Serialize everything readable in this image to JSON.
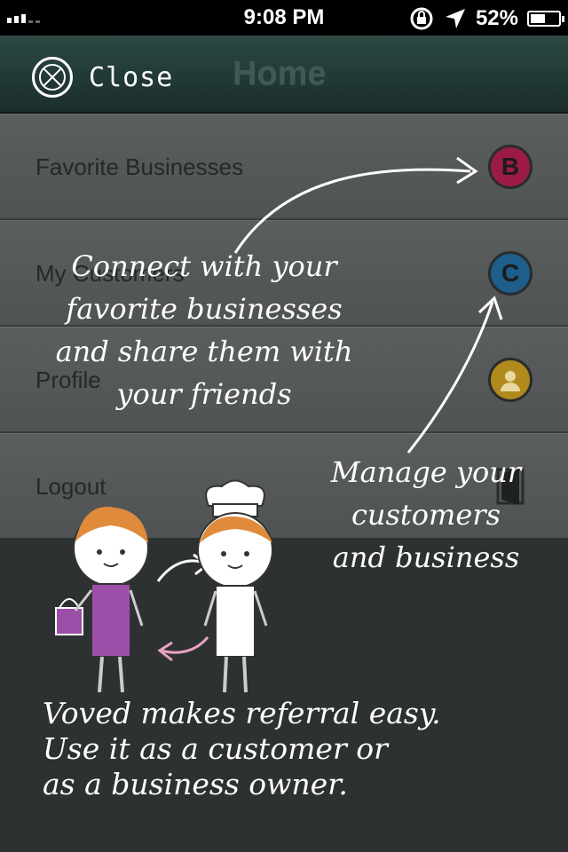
{
  "status_bar": {
    "time": "9:08 PM",
    "battery": "52%",
    "battery_level": 0.52
  },
  "nav": {
    "close_label": "Close",
    "title": "Home"
  },
  "menu": {
    "items": [
      {
        "label": "Favorite Businesses",
        "icon": "favorite-businesses-icon",
        "icon_text": "B"
      },
      {
        "label": "My Customers",
        "icon": "my-customers-icon",
        "icon_text": "C"
      },
      {
        "label": "Profile",
        "icon": "profile-icon",
        "icon_text": ""
      },
      {
        "label": "Logout",
        "icon": "logout-icon",
        "icon_text": ""
      }
    ]
  },
  "overlay": {
    "connect_lines": [
      "Connect with your",
      "favorite businesses",
      "and share them with",
      "your friends"
    ],
    "manage_lines": [
      "Manage your",
      "customers",
      "and business"
    ],
    "bottom_lines": [
      "Voved makes referral easy.",
      "Use it as a customer or",
      "as a business owner."
    ]
  },
  "colors": {
    "navbar": "#22393a",
    "menu_bg": "#565959",
    "overlay_bg": "#2e3131",
    "accent_b": "#9c1b46",
    "accent_c": "#1d5e8a",
    "accent_profile": "#b08a1c",
    "character_dress": "#9b4fa8"
  }
}
